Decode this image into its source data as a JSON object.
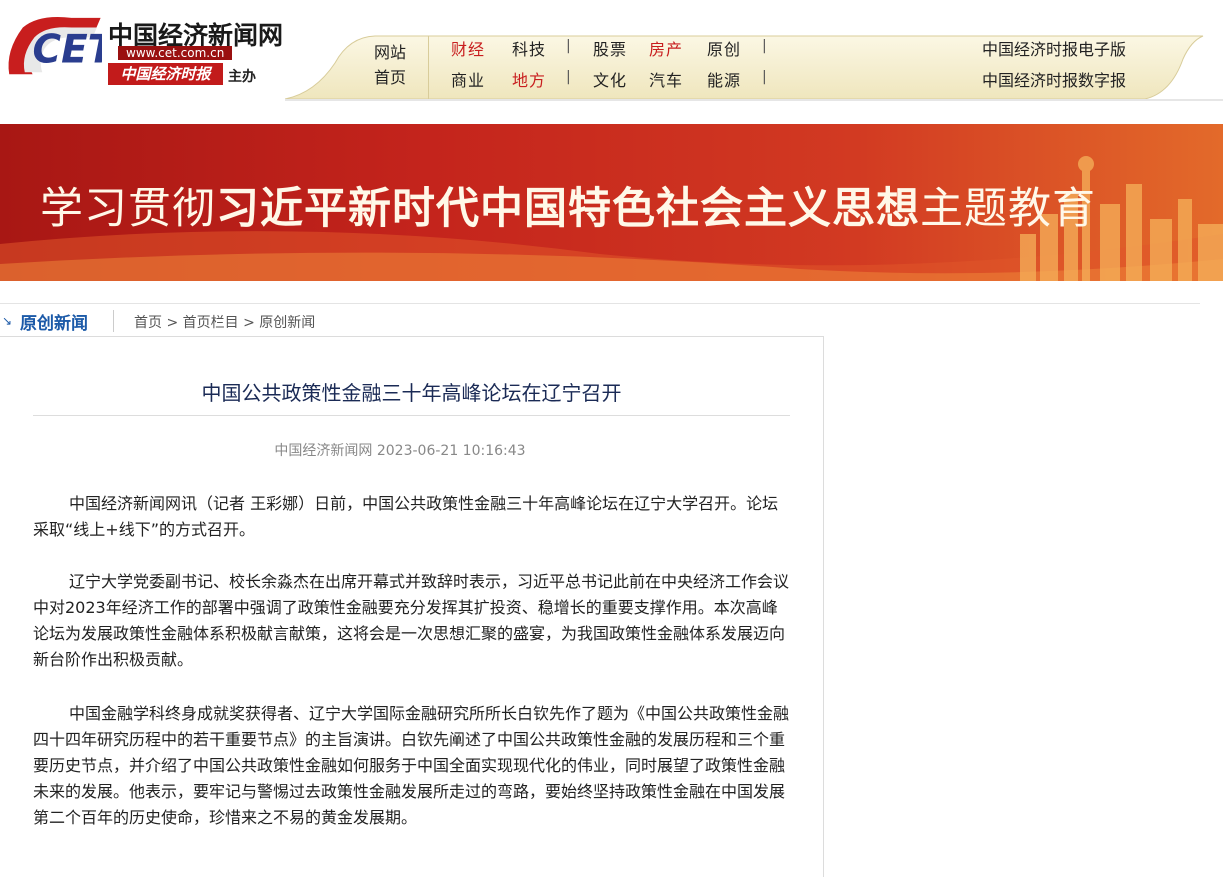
{
  "header": {
    "logo_title": "中国经济新闻网",
    "logo_url": "www.cet.com.cn",
    "logo_paper": "中国经济时报",
    "logo_host": "主办",
    "home_line1": "网站",
    "home_line2": "首页"
  },
  "nav": {
    "row1": [
      "财经",
      "科技",
      "股票",
      "房产",
      "原创"
    ],
    "row2": [
      "商业",
      "地方",
      "文化",
      "汽车",
      "能源"
    ],
    "sep": "|",
    "right1": "中国经济时报电子版",
    "right2": "中国经济时报数字报"
  },
  "banner": {
    "text_light": "学习贯彻",
    "text_bold": "习近平新时代中国特色社会主义思想",
    "text_end": "主题教育"
  },
  "section": {
    "title": "原创新闻",
    "breadcrumb": "首页 > 首页栏目 > 原创新闻"
  },
  "article": {
    "title": "中国公共政策性金融三十年高峰论坛在辽宁召开",
    "meta": "中国经济新闻网 2023-06-21 10:16:43",
    "paragraphs": [
      "中国经济新闻网讯（记者 王彩娜）日前，中国公共政策性金融三十年高峰论坛在辽宁大学召开。论坛采取“线上+线下”的方式召开。",
      "辽宁大学党委副书记、校长余淼杰在出席开幕式并致辞时表示，习近平总书记此前在中央经济工作会议中对2023年经济工作的部署中强调了政策性金融要充分发挥其扩投资、稳增长的重要支撑作用。本次高峰论坛为发展政策性金融体系积极献言献策，这将会是一次思想汇聚的盛宴，为我国政策性金融体系发展迈向新台阶作出积极贡献。",
      "中国金融学科终身成就奖获得者、辽宁大学国际金融研究所所长白钦先作了题为《中国公共政策性金融四十四年研究历程中的若干重要节点》的主旨演讲。白钦先阐述了中国公共政策性金融的发展历程和三个重要历史节点，并介绍了中国公共政策性金融如何服务于中国全面实现现代化的伟业，同时展望了政策性金融未来的发展。他表示，要牢记与警惕过去政策性金融发展所走过的弯路，要始终坚持政策性金融在中国发展第二个百年的历史使命，珍惜来之不易的黄金发展期。"
    ]
  },
  "colors": {
    "accent_red": "#c81e1e",
    "section_blue": "#1c5aa8",
    "nav_band": "#f7f1d6"
  }
}
